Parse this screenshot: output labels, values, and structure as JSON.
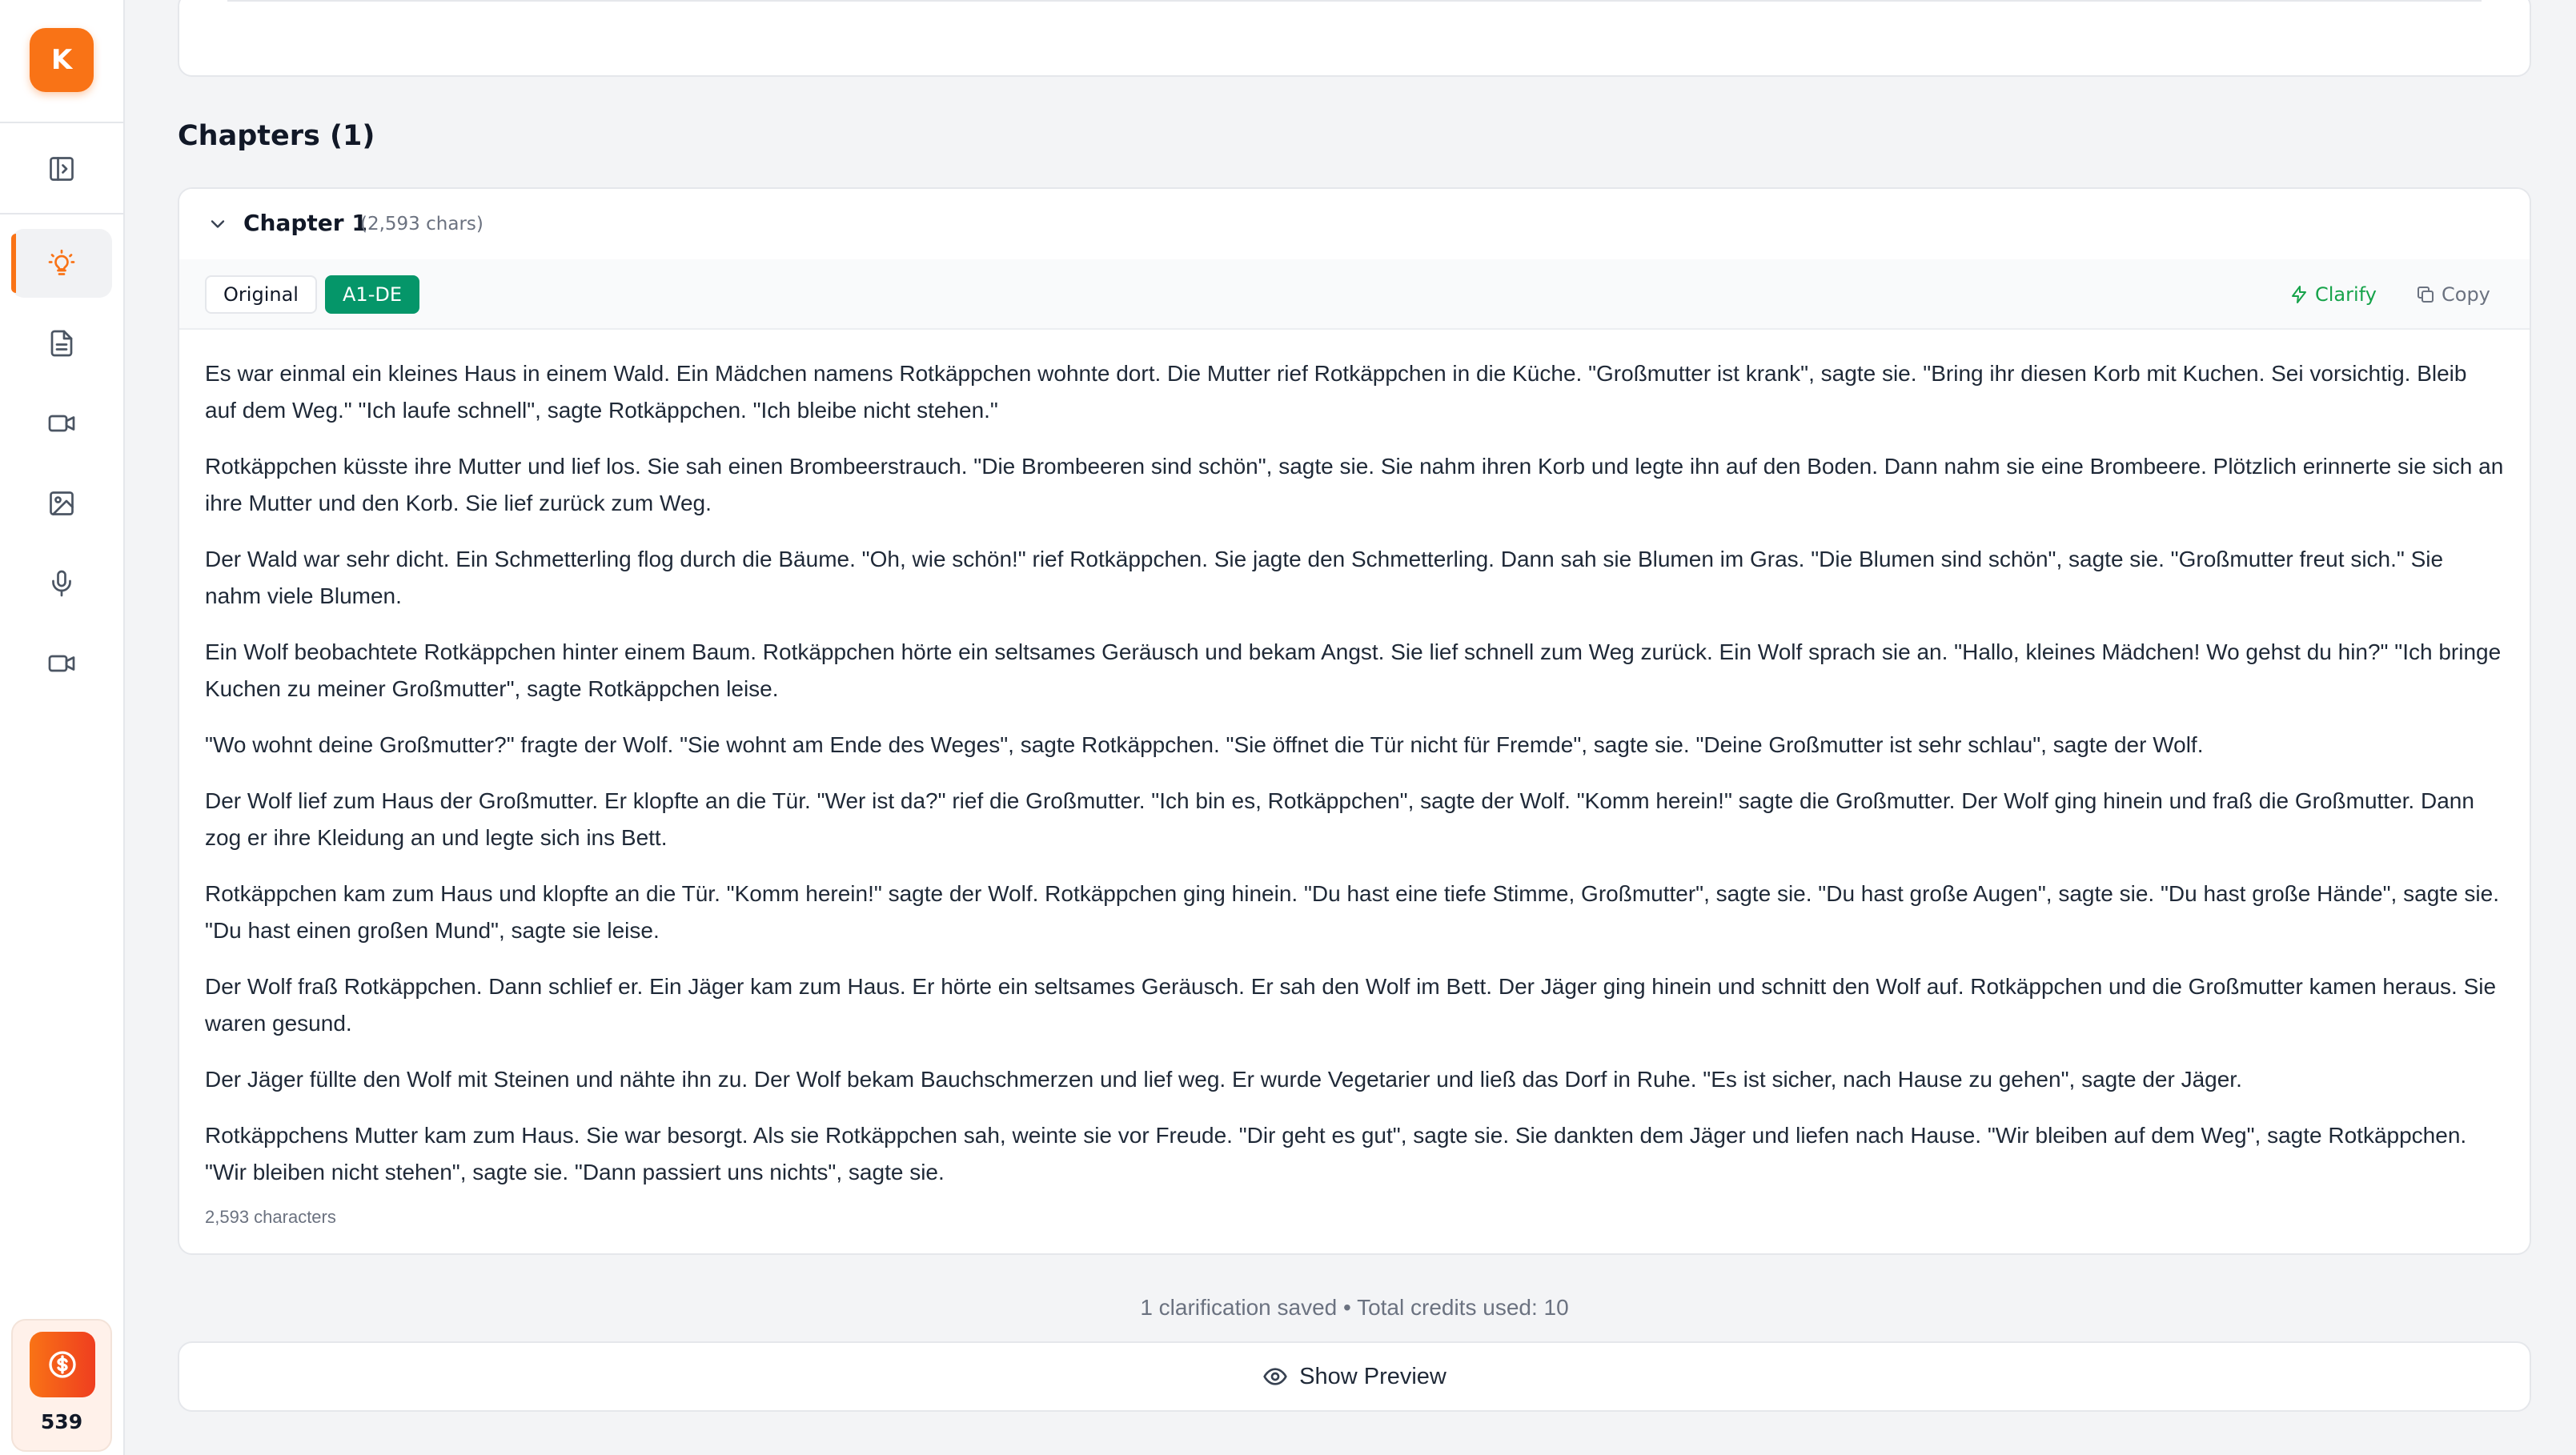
{
  "sidebar": {
    "logo_letter": "K",
    "items": [
      {
        "icon": "panel-toggle-icon"
      },
      {
        "icon": "lightbulb-icon",
        "active": true
      },
      {
        "icon": "document-icon"
      },
      {
        "icon": "video-icon"
      },
      {
        "icon": "image-icon"
      },
      {
        "icon": "microphone-icon"
      },
      {
        "icon": "video-icon"
      }
    ],
    "credits": {
      "icon": "dollar-coin-icon",
      "count": "539"
    }
  },
  "chapters": {
    "heading": "Chapters (1)",
    "chapter": {
      "title": "Chapter 1",
      "char_info": "(2,593 chars)",
      "tabs": {
        "original": "Original",
        "active": "A1-DE"
      },
      "actions": {
        "clarify": "Clarify",
        "copy": "Copy"
      },
      "paragraphs": [
        "Es war einmal ein kleines Haus in einem Wald. Ein Mädchen namens Rotkäppchen wohnte dort. Die Mutter rief Rotkäppchen in die Küche. \"Großmutter ist krank\", sagte sie. \"Bring ihr diesen Korb mit Kuchen. Sei vorsichtig. Bleib auf dem Weg.\" \"Ich laufe schnell\", sagte Rotkäppchen. \"Ich bleibe nicht stehen.\"",
        "Rotkäppchen küsste ihre Mutter und lief los. Sie sah einen Brombeerstrauch. \"Die Brombeeren sind schön\", sagte sie. Sie nahm ihren Korb und legte ihn auf den Boden. Dann nahm sie eine Brombeere. Plötzlich erinnerte sie sich an ihre Mutter und den Korb. Sie lief zurück zum Weg.",
        "Der Wald war sehr dicht. Ein Schmetterling flog durch die Bäume. \"Oh, wie schön!\" rief Rotkäppchen. Sie jagte den Schmetterling. Dann sah sie Blumen im Gras. \"Die Blumen sind schön\", sagte sie. \"Großmutter freut sich.\" Sie nahm viele Blumen.",
        "Ein Wolf beobachtete Rotkäppchen hinter einem Baum. Rotkäppchen hörte ein seltsames Geräusch und bekam Angst. Sie lief schnell zum Weg zurück. Ein Wolf sprach sie an. \"Hallo, kleines Mädchen! Wo gehst du hin?\" \"Ich bringe Kuchen zu meiner Großmutter\", sagte Rotkäppchen leise.",
        "\"Wo wohnt deine Großmutter?\" fragte der Wolf. \"Sie wohnt am Ende des Weges\", sagte Rotkäppchen. \"Sie öffnet die Tür nicht für Fremde\", sagte sie. \"Deine Großmutter ist sehr schlau\", sagte der Wolf.",
        "Der Wolf lief zum Haus der Großmutter. Er klopfte an die Tür. \"Wer ist da?\" rief die Großmutter. \"Ich bin es, Rotkäppchen\", sagte der Wolf. \"Komm herein!\" sagte die Großmutter. Der Wolf ging hinein und fraß die Großmutter. Dann zog er ihre Kleidung an und legte sich ins Bett.",
        "Rotkäppchen kam zum Haus und klopfte an die Tür. \"Komm herein!\" sagte der Wolf. Rotkäppchen ging hinein. \"Du hast eine tiefe Stimme, Großmutter\", sagte sie. \"Du hast große Augen\", sagte sie. \"Du hast große Hände\", sagte sie. \"Du hast einen großen Mund\", sagte sie leise.",
        "Der Wolf fraß Rotkäppchen. Dann schlief er. Ein Jäger kam zum Haus. Er hörte ein seltsames Geräusch. Er sah den Wolf im Bett. Der Jäger ging hinein und schnitt den Wolf auf. Rotkäppchen und die Großmutter kamen heraus. Sie waren gesund.",
        "Der Jäger füllte den Wolf mit Steinen und nähte ihn zu. Der Wolf bekam Bauchschmerzen und lief weg. Er wurde Vegetarier und ließ das Dorf in Ruhe. \"Es ist sicher, nach Hause zu gehen\", sagte der Jäger.",
        "Rotkäppchens Mutter kam zum Haus. Sie war besorgt. Als sie Rotkäppchen sah, weinte sie vor Freude. \"Dir geht es gut\", sagte sie. Sie dankten dem Jäger und liefen nach Hause. \"Wir bleiben auf dem Weg\", sagte Rotkäppchen. \"Wir bleiben nicht stehen\", sagte sie. \"Dann passiert uns nichts\", sagte sie."
      ],
      "char_count": "2,593 characters"
    }
  },
  "status": "1 clarification saved • Total credits used: 10",
  "preview_button": {
    "label": "Show Preview",
    "icon": "eye-icon"
  },
  "colors": {
    "accent": "#f97316",
    "active_tab": "#059669",
    "clarify": "#16a34a"
  }
}
